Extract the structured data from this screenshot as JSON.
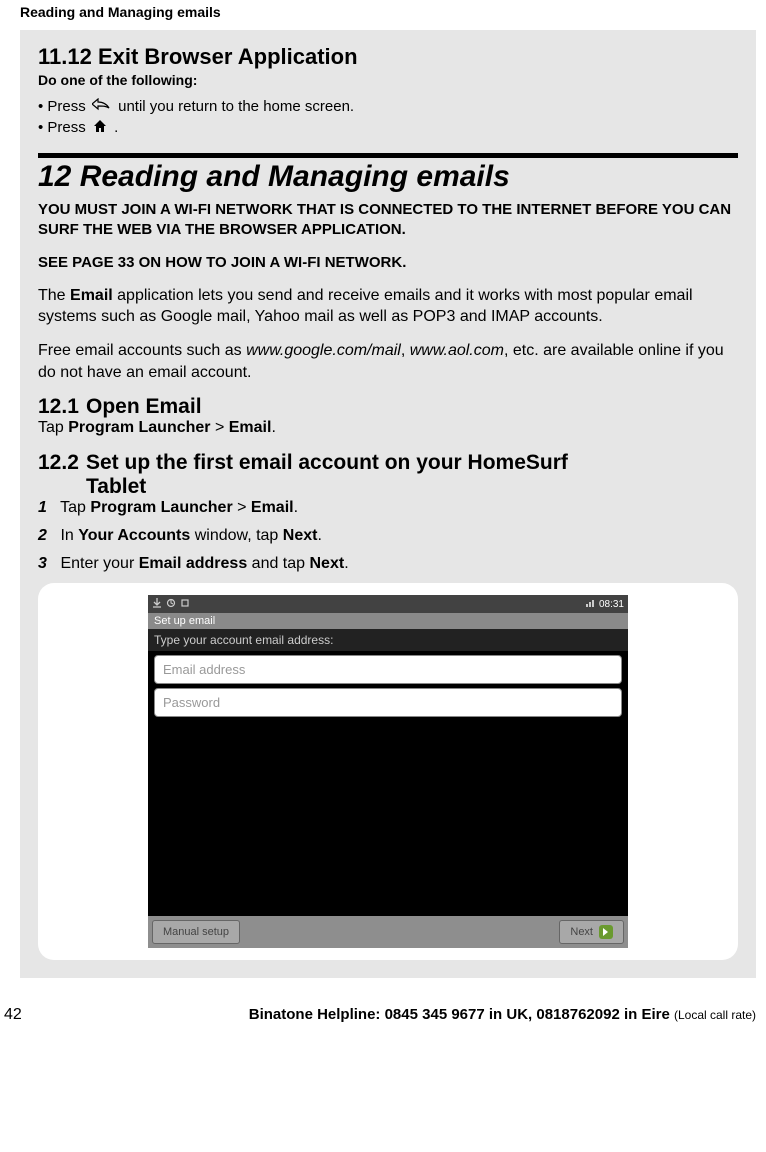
{
  "running_header": "Reading and Managing emails",
  "sec_11_12": {
    "heading": "11.12 Exit Browser Application",
    "subheading": "Do one of the following:",
    "item1_pre": "•  Press ",
    "item1_post": "  until you return to the home screen.",
    "item2_pre": "•  Press ",
    "item2_post": " ."
  },
  "chapter": {
    "heading": "12  Reading and Managing emails",
    "caps1": "YOU MUST JOIN A WI-FI NETWORK THAT IS CONNECTED TO THE INTERNET BEFORE YOU CAN SURF THE WEB VIA THE BROWSER APPLICATION.",
    "caps2": "SEE PAGE 33 ON HOW TO JOIN A WI-FI NETWORK.",
    "para1_pre": "The ",
    "para1_b1": "Email",
    "para1_post": " application lets you send and receive emails and it works with most popular email systems such as Google mail, Yahoo mail as well as POP3 and IMAP accounts.",
    "para2_pre": "Free email accounts such as ",
    "para2_i1": "www.google.com/mail",
    "para2_mid": ", ",
    "para2_i2": "www.aol.com",
    "para2_post": ", etc. are available online if you do not have an email account."
  },
  "sec_12_1": {
    "num": "12.1",
    "title": "Open Email",
    "line_pre": "Tap ",
    "line_b1": "Program Launcher",
    "line_mid": " > ",
    "line_b2": "Email",
    "line_post": "."
  },
  "sec_12_2": {
    "num": "12.2",
    "title_l1": "Set up the first email account on your HomeSurf",
    "title_l2": "Tablet",
    "steps": [
      {
        "n": "1",
        "pre": "Tap ",
        "b1": "Program Launcher",
        "mid": " > ",
        "b2": "Email",
        "post": "."
      },
      {
        "n": "2",
        "pre": "In ",
        "b1": "Your Accounts",
        "mid": " window, tap ",
        "b2": "Next",
        "post": "."
      },
      {
        "n": "3",
        "pre": "Enter your ",
        "b1": "Email address",
        "mid": " and tap ",
        "b2": "Next",
        "post": "."
      }
    ]
  },
  "screenshot": {
    "time": "08:31",
    "title_bar": "Set up email",
    "subtitle": "Type your account email address:",
    "email_ph": "Email address",
    "password_ph": "Password",
    "manual_btn": "Manual setup",
    "next_btn": "Next"
  },
  "footer": {
    "page": "42",
    "helpline": "Binatone Helpline: 0845 345 9677 in UK, 0818762092 in Eire ",
    "local": "(Local call rate)"
  },
  "chart_data": null
}
